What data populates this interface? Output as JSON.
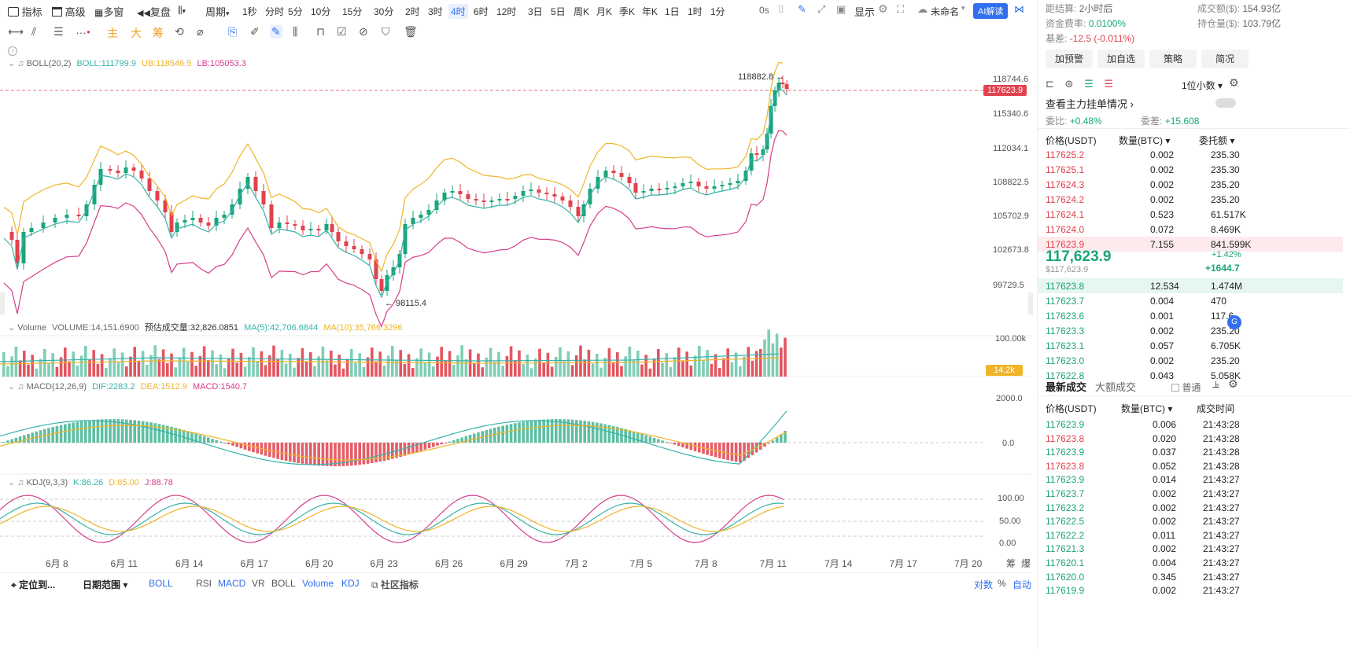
{
  "toolbar": {
    "indicator": "指标",
    "advanced": "高级",
    "multi": "多窗",
    "replay": "复盘",
    "period": "周期",
    "intervals": [
      "1秒",
      "分时",
      "5分",
      "10分",
      "15分",
      "30分",
      "2时",
      "3时",
      "4时",
      "6时",
      "12时",
      "3日",
      "5日",
      "周K",
      "月K",
      "季K",
      "年K",
      "1日",
      "1时",
      "1分"
    ],
    "selected_interval": "4时",
    "countdown": "0s",
    "display": "显示",
    "unnamed": "未命名",
    "ai": "AI解读",
    "draw_tools": [
      "主",
      "大",
      "筹"
    ]
  },
  "boll_legend": {
    "name": "BOLL(20,2)",
    "boll": "BOLL:111799.9",
    "ub": "UB:118546.5",
    "lb": "LB:105053.3"
  },
  "vol_legend": {
    "name": "Volume",
    "vol": "VOLUME:14,151.6900",
    "est": "预估成交量:32,826.0851",
    "ma5": "MA(5):42,706.6844",
    "ma10": "MA(10):35,766.3296"
  },
  "macd_legend": {
    "name": "MACD(12,26,9)",
    "dif": "DIF:2283.2",
    "dea": "DEA:1512.9",
    "macd": "MACD:1540.7"
  },
  "kdj_legend": {
    "name": "KDJ(9,3,3)",
    "k": "K:86.26",
    "d": "D:85.00",
    "j": "J:88.78"
  },
  "price_axis": [
    "118744.6",
    "115340.6",
    "112034.1",
    "108822.5",
    "105702.9",
    "102673.8",
    "99729.5"
  ],
  "current_price_label": "117623.9",
  "high_mark": "118882.8 →",
  "low_mark": "← 98115.4",
  "vol_axis": [
    "100.00k"
  ],
  "vol_tag": "14.2k",
  "macd_axis": [
    "2000.0",
    "0.0"
  ],
  "kdj_axis": [
    "100.00",
    "50.00",
    "0.00"
  ],
  "dates": [
    "6月 8",
    "6月 11",
    "6月 14",
    "6月 17",
    "6月 20",
    "6月 23",
    "6月 26",
    "6月 29",
    "7月 2",
    "7月 5",
    "7月 8",
    "7月 11",
    "7月 14",
    "7月 17",
    "7月 20"
  ],
  "corner": [
    "筹",
    "爆"
  ],
  "bottom": {
    "locate": "定位到...",
    "range": "日期范围",
    "boll": "BOLL",
    "inds": [
      "RSI",
      "MACD",
      "VR",
      "BOLL",
      "Volume",
      "KDJ"
    ],
    "community": "社区指标",
    "log": "对数",
    "pct": "%",
    "auto": "自动"
  },
  "panel": {
    "settle_label": "距结算:",
    "settle_val": "2小时后",
    "turn_label": "成交额($):",
    "turn_val": "154.93亿",
    "fund_label": "资金费率:",
    "fund_val": "0.0100%",
    "oi_label": "持仓量($):",
    "oi_val": "103.79亿",
    "basis_label": "基差:",
    "basis_val": "-12.5 (-0.011%)",
    "buttons": [
      "加预警",
      "加自选",
      "策略",
      "简况"
    ],
    "decimals": "1位小数",
    "main_orders": "查看主力挂单情况",
    "ratio_label": "委比:",
    "ratio_val": "+0.48%",
    "diff_label": "委差:",
    "diff_val": "+15.608",
    "headers": [
      "价格(USDT)",
      "数量(BTC)",
      "委托额"
    ],
    "asks": [
      [
        "117625.2",
        "0.002",
        "235.30"
      ],
      [
        "117625.1",
        "0.002",
        "235.30"
      ],
      [
        "117624.3",
        "0.002",
        "235.20"
      ],
      [
        "117624.2",
        "0.002",
        "235.20"
      ],
      [
        "117624.1",
        "0.523",
        "61.517K"
      ],
      [
        "117624.0",
        "0.072",
        "8.469K"
      ],
      [
        "117623.9",
        "7.155",
        "841.599K"
      ]
    ],
    "last": "117,623.9",
    "last_usd": "$117,623.9",
    "chg_pct": "+1.42%",
    "chg": "+1644.7",
    "bids": [
      [
        "117623.8",
        "12.534",
        "1.474M"
      ],
      [
        "117623.7",
        "0.004",
        "470"
      ],
      [
        "117623.6",
        "0.001",
        "117.6"
      ],
      [
        "117623.3",
        "0.002",
        "235.20"
      ],
      [
        "117623.1",
        "0.057",
        "6.705K"
      ],
      [
        "117623.0",
        "0.002",
        "235.20"
      ],
      [
        "117622.8",
        "0.043",
        "5.058K"
      ]
    ],
    "trade_tabs": [
      "最新成交",
      "大额成交"
    ],
    "normal": "普通",
    "trade_headers": [
      "价格(USDT)",
      "数量(BTC)",
      "成交时间"
    ],
    "trades": [
      [
        "117623.9",
        "0.006",
        "21:43:28",
        "g"
      ],
      [
        "117623.8",
        "0.020",
        "21:43:28",
        "r"
      ],
      [
        "117623.9",
        "0.037",
        "21:43:28",
        "g"
      ],
      [
        "117623.8",
        "0.052",
        "21:43:28",
        "r"
      ],
      [
        "117623.9",
        "0.014",
        "21:43:27",
        "g"
      ],
      [
        "117623.7",
        "0.002",
        "21:43:27",
        "g"
      ],
      [
        "117623.2",
        "0.002",
        "21:43:27",
        "g"
      ],
      [
        "117622.5",
        "0.002",
        "21:43:27",
        "g"
      ],
      [
        "117622.2",
        "0.011",
        "21:43:27",
        "g"
      ],
      [
        "117621.3",
        "0.002",
        "21:43:27",
        "g"
      ],
      [
        "117620.1",
        "0.004",
        "21:43:27",
        "g"
      ],
      [
        "117620.0",
        "0.345",
        "21:43:27",
        "g"
      ],
      [
        "117619.9",
        "0.002",
        "21:43:27",
        "g"
      ]
    ]
  },
  "colors": {
    "up": "#1aa47a",
    "down": "#e0424e",
    "ub": "#f0b429",
    "lb": "#d63d8c",
    "mid": "#36b3a8"
  }
}
